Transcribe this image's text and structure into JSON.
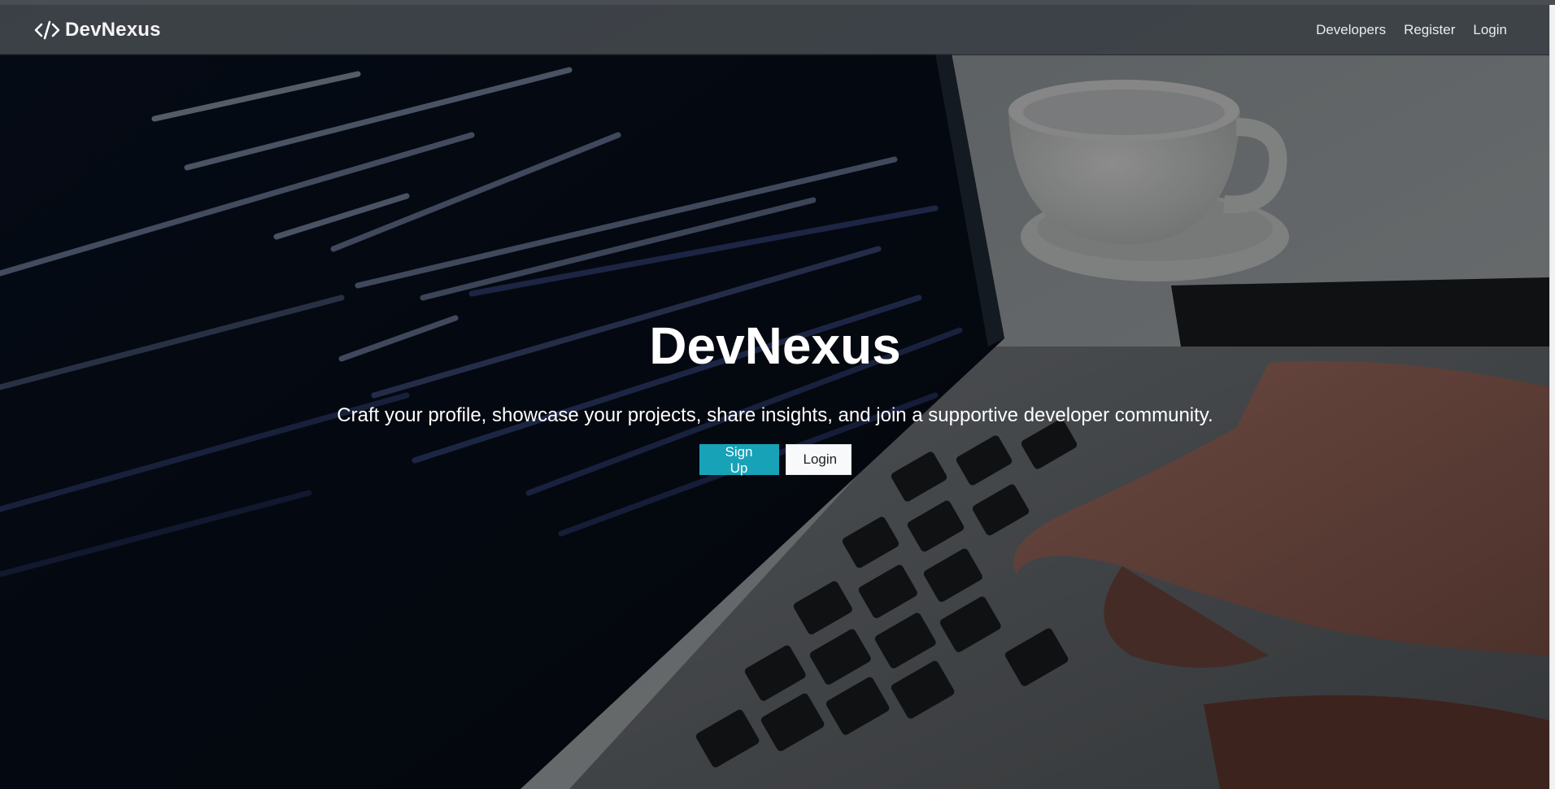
{
  "navbar": {
    "brand": {
      "icon": "code-icon",
      "name": "DevNexus"
    },
    "links": [
      {
        "label": "Developers"
      },
      {
        "label": "Register"
      },
      {
        "label": "Login"
      }
    ]
  },
  "hero": {
    "title": "DevNexus",
    "subtitle": "Craft your profile, showcase your projects, share insights, and join a supportive developer community.",
    "buttons": {
      "signup": "Sign Up",
      "login": "Login"
    },
    "background": "laptop-code-keyboard-photo"
  },
  "colors": {
    "primary": "#17a2b8",
    "light": "#f8f9fa",
    "navbar": "#343a40"
  }
}
